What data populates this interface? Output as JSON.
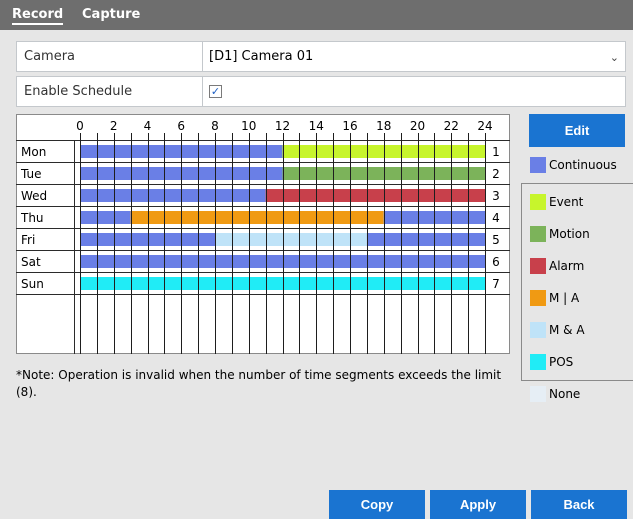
{
  "tabs": [
    {
      "label": "Record",
      "active": true
    },
    {
      "label": "Capture",
      "active": false
    }
  ],
  "form": {
    "camera_label": "Camera",
    "camera_value": "[D1] Camera 01",
    "enable_label": "Enable Schedule",
    "enable_checked": true
  },
  "schedule": {
    "hour_labels": [
      "0",
      "2",
      "4",
      "6",
      "8",
      "10",
      "12",
      "14",
      "16",
      "18",
      "20",
      "22",
      "24"
    ],
    "rows": [
      {
        "day": "Mon",
        "num": "1",
        "segments": [
          {
            "start": 0,
            "end": 12,
            "type": "continuous"
          },
          {
            "start": 12,
            "end": 24,
            "type": "event"
          }
        ]
      },
      {
        "day": "Tue",
        "num": "2",
        "segments": [
          {
            "start": 0,
            "end": 12,
            "type": "continuous"
          },
          {
            "start": 12,
            "end": 24,
            "type": "motion"
          }
        ]
      },
      {
        "day": "Wed",
        "num": "3",
        "segments": [
          {
            "start": 0,
            "end": 11,
            "type": "continuous"
          },
          {
            "start": 11,
            "end": 24,
            "type": "alarm"
          }
        ]
      },
      {
        "day": "Thu",
        "num": "4",
        "segments": [
          {
            "start": 0,
            "end": 3,
            "type": "continuous"
          },
          {
            "start": 3,
            "end": 18,
            "type": "m_or_a"
          },
          {
            "start": 18,
            "end": 24,
            "type": "continuous"
          }
        ]
      },
      {
        "day": "Fri",
        "num": "5",
        "segments": [
          {
            "start": 0,
            "end": 8,
            "type": "continuous"
          },
          {
            "start": 8,
            "end": 17,
            "type": "m_and_a"
          },
          {
            "start": 17,
            "end": 24,
            "type": "continuous"
          }
        ]
      },
      {
        "day": "Sat",
        "num": "6",
        "segments": [
          {
            "start": 0,
            "end": 24,
            "type": "continuous"
          }
        ]
      },
      {
        "day": "Sun",
        "num": "7",
        "segments": [
          {
            "start": 0,
            "end": 24,
            "type": "pos"
          }
        ]
      }
    ]
  },
  "note": "*Note: Operation is invalid when the number of time segments exceeds the limit (8).",
  "edit_label": "Edit",
  "legend": [
    {
      "key": "continuous",
      "label": "Continuous",
      "color": "#6a7fe6"
    },
    {
      "key": "event",
      "label": "Event",
      "color": "#c7f52c"
    },
    {
      "key": "motion",
      "label": "Motion",
      "color": "#7cb35a"
    },
    {
      "key": "alarm",
      "label": "Alarm",
      "color": "#c8404b"
    },
    {
      "key": "m_or_a",
      "label": "M | A",
      "color": "#f09a13"
    },
    {
      "key": "m_and_a",
      "label": "M & A",
      "color": "#bfe3f8"
    },
    {
      "key": "pos",
      "label": "POS",
      "color": "#20ecf6"
    },
    {
      "key": "none",
      "label": "None",
      "color": "#e6eef5"
    }
  ],
  "buttons": {
    "copy": "Copy",
    "apply": "Apply",
    "back": "Back"
  }
}
